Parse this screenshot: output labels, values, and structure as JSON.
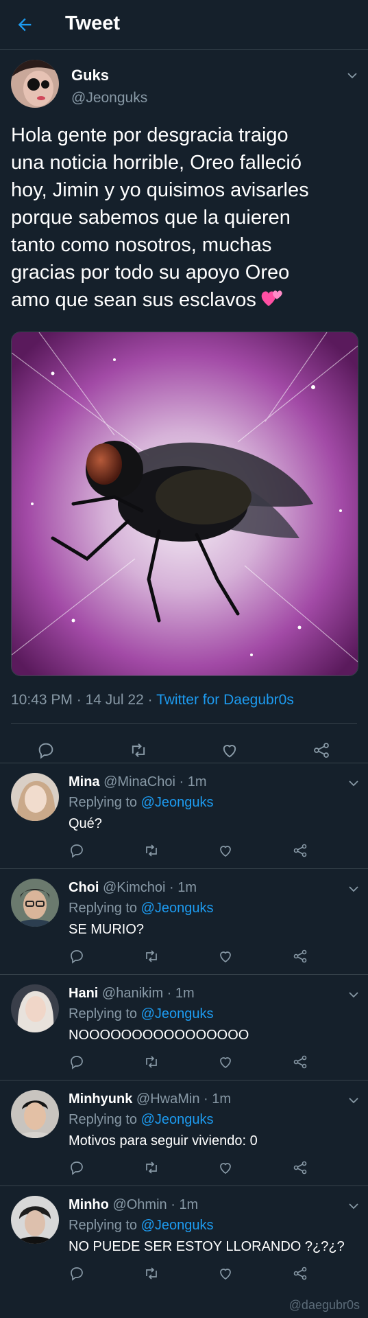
{
  "header": {
    "title": "Tweet"
  },
  "tweet": {
    "author_name": "Guks",
    "author_handle": "@Jeonguks",
    "text": "Hola gente por desgracia traigo\nuna noticia horrible, Oreo falleció\nhoy, Jimin y yo quisimos avisarles\nporque sabemos que la quieren\ntanto como nosotros, muchas\ngracias por todo su apoyo Oreo\namo que sean sus esclavos",
    "emoji": "two-hearts-emoji",
    "time": "10:43 PM",
    "date": "14 Jul 22",
    "source": "Twitter for Daegubr0s"
  },
  "replies": [
    {
      "name": "Mina",
      "handle": "@MinaChoi",
      "time": "1m",
      "replying_prefix": "Replying to",
      "replying_handle": "@Jeonguks",
      "text": "Qué?"
    },
    {
      "name": "Choi",
      "handle": "@Kimchoi",
      "time": "1m",
      "replying_prefix": "Replying to",
      "replying_handle": "@Jeonguks",
      "text": "SE MURIO?"
    },
    {
      "name": "Hani",
      "handle": "@hanikim",
      "time": "1m",
      "replying_prefix": "Replying to",
      "replying_handle": "@Jeonguks",
      "text": "NOOOOOOOOOOOOOOOO"
    },
    {
      "name": "Minhyunk",
      "handle": "@HwaMin",
      "time": "1m",
      "replying_prefix": "Replying to",
      "replying_handle": "@Jeonguks",
      "text": "Motivos para seguir viviendo: 0"
    },
    {
      "name": "Minho",
      "handle": "@Ohmin",
      "time": "1m",
      "replying_prefix": "Replying to",
      "replying_handle": "@Jeonguks",
      "text": "NO PUEDE SER ESTOY LLORANDO ?¿?¿?"
    }
  ],
  "watermark": "@daegubr0s",
  "colors": {
    "background": "#15202b",
    "accent": "#1d9bf0",
    "muted": "#8899a6",
    "divider": "#38444d"
  },
  "icons": [
    "back-arrow-icon",
    "chevron-down-icon",
    "reply-icon",
    "retweet-icon",
    "like-icon",
    "share-icon"
  ]
}
